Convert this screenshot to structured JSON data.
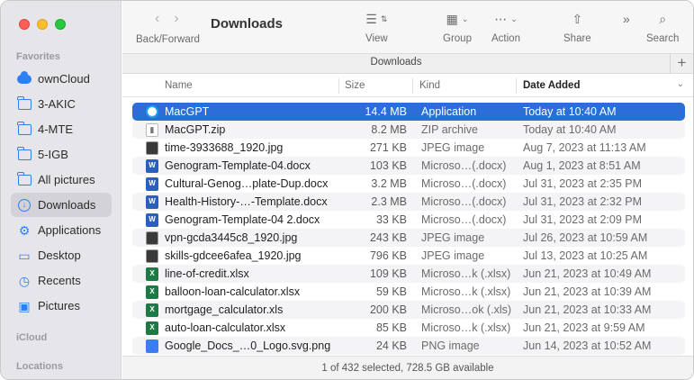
{
  "window": {
    "title": "Downloads"
  },
  "sidebar": {
    "favorites_heading": "Favorites",
    "items": [
      {
        "label": "ownCloud",
        "icon": "cloud-icon"
      },
      {
        "label": "3-AKIC",
        "icon": "folder-icon"
      },
      {
        "label": "4-MTE",
        "icon": "folder-icon"
      },
      {
        "label": "5-IGB",
        "icon": "folder-icon"
      },
      {
        "label": "All pictures",
        "icon": "folder-icon"
      },
      {
        "label": "Downloads",
        "icon": "download-icon",
        "active": true
      },
      {
        "label": "Applications",
        "icon": "applications-icon"
      },
      {
        "label": "Desktop",
        "icon": "desktop-icon"
      },
      {
        "label": "Recents",
        "icon": "clock-icon"
      },
      {
        "label": "Pictures",
        "icon": "photo-icon"
      }
    ],
    "icloud_heading": "iCloud",
    "locations_heading": "Locations"
  },
  "toolbar": {
    "nav_label": "Back/Forward",
    "view_label": "View",
    "group_label": "Group",
    "action_label": "Action",
    "share_label": "Share",
    "more_label": "»",
    "search_label": "Search"
  },
  "tab": {
    "title": "Downloads",
    "add": "+"
  },
  "columns": {
    "name": "Name",
    "size": "Size",
    "kind": "Kind",
    "date": "Date Added"
  },
  "files": [
    {
      "name": "MacGPT",
      "size": "14.4 MB",
      "kind": "Application",
      "date": "Today at 10:40 AM",
      "type": "app",
      "selected": true
    },
    {
      "name": "MacGPT.zip",
      "size": "8.2 MB",
      "kind": "ZIP archive",
      "date": "Today at 10:40 AM",
      "type": "zip"
    },
    {
      "name": "time-3933688_1920.jpg",
      "size": "271 KB",
      "kind": "JPEG image",
      "date": "Aug 7, 2023 at 11:13 AM",
      "type": "jpg"
    },
    {
      "name": "Genogram-Template-04.docx",
      "size": "103 KB",
      "kind": "Microso…(.docx)",
      "date": "Aug 1, 2023 at 8:51 AM",
      "type": "doc"
    },
    {
      "name": "Cultural-Genog…plate-Dup.docx",
      "size": "3.2 MB",
      "kind": "Microso…(.docx)",
      "date": "Jul 31, 2023 at 2:35 PM",
      "type": "doc"
    },
    {
      "name": "Health-History-…-Template.docx",
      "size": "2.3 MB",
      "kind": "Microso…(.docx)",
      "date": "Jul 31, 2023 at 2:32 PM",
      "type": "doc"
    },
    {
      "name": "Genogram-Template-04 2.docx",
      "size": "33 KB",
      "kind": "Microso…(.docx)",
      "date": "Jul 31, 2023 at 2:09 PM",
      "type": "doc"
    },
    {
      "name": "vpn-gcda3445c8_1920.jpg",
      "size": "243 KB",
      "kind": "JPEG image",
      "date": "Jul 26, 2023 at 10:59 AM",
      "type": "jpg"
    },
    {
      "name": "skills-gdcee6afea_1920.jpg",
      "size": "796 KB",
      "kind": "JPEG image",
      "date": "Jul 13, 2023 at 10:25 AM",
      "type": "jpg"
    },
    {
      "name": "line-of-credit.xlsx",
      "size": "109 KB",
      "kind": "Microso…k (.xlsx)",
      "date": "Jun 21, 2023 at 10:49 AM",
      "type": "xls"
    },
    {
      "name": "balloon-loan-calculator.xlsx",
      "size": "59 KB",
      "kind": "Microso…k (.xlsx)",
      "date": "Jun 21, 2023 at 10:39 AM",
      "type": "xls"
    },
    {
      "name": "mortgage_calculator.xls",
      "size": "200 KB",
      "kind": "Microso…ok (.xls)",
      "date": "Jun 21, 2023 at 10:33 AM",
      "type": "xls"
    },
    {
      "name": "auto-loan-calculator.xlsx",
      "size": "85 KB",
      "kind": "Microso…k (.xlsx)",
      "date": "Jun 21, 2023 at 9:59 AM",
      "type": "xls"
    },
    {
      "name": "Google_Docs_…0_Logo.svg.png",
      "size": "24 KB",
      "kind": "PNG image",
      "date": "Jun 14, 2023 at 10:52 AM",
      "type": "png"
    }
  ],
  "status": {
    "text": "1 of 432 selected, 728.5 GB available"
  }
}
